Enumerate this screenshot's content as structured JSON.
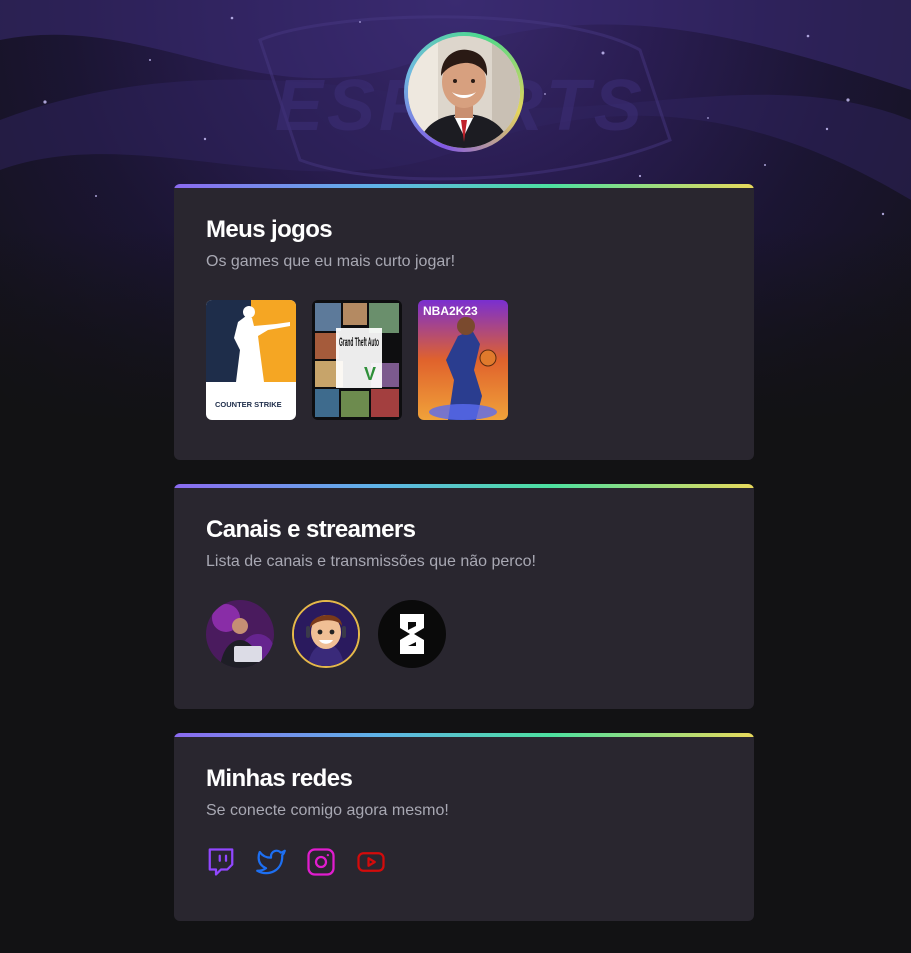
{
  "profile": {
    "avatar_icon": "profile-photo"
  },
  "games_card": {
    "title": "Meus jogos",
    "subtitle": "Os games que eu mais curto jogar!",
    "games": [
      {
        "name": "Counter Strike",
        "logo_text": "COUNTER STRIKE"
      },
      {
        "name": "Grand Theft Auto V",
        "logo_text": "Grand Theft Auto"
      },
      {
        "name": "NBA 2K23",
        "logo_text": "NBA2K23"
      }
    ]
  },
  "channels_card": {
    "title": "Canais e streamers",
    "subtitle": "Lista de canais e transmissões que não perco!"
  },
  "socials_card": {
    "title": "Minhas redes",
    "subtitle": "Se conecte comigo agora mesmo!",
    "icons": [
      "twitch-icon",
      "twitter-icon",
      "instagram-icon",
      "youtube-icon"
    ],
    "colors": {
      "twitch": "#9147ff",
      "twitter": "#1d6ff2",
      "instagram": "#e11ccf",
      "youtube": "#d30b0b"
    }
  },
  "theme": {
    "card_bg": "#29262f",
    "page_bg": "#121214",
    "title_color": "#ffffff",
    "subtitle_color": "#a8a8b3"
  }
}
